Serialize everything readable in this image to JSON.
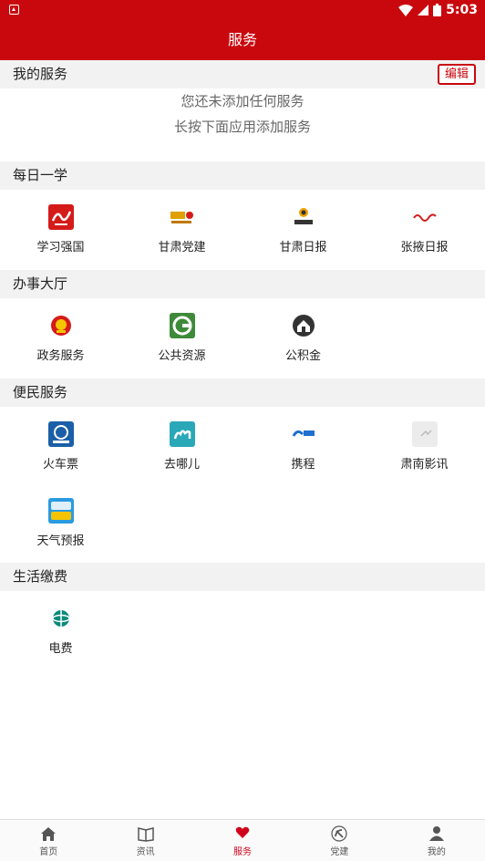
{
  "status_bar": {
    "time": "5:03"
  },
  "app_bar": {
    "title": "服务"
  },
  "my_services": {
    "title": "我的服务",
    "edit_label": "编辑",
    "empty_line1": "您还未添加任何服务",
    "empty_line2": "长按下面应用添加服务"
  },
  "sections": [
    {
      "title": "每日一学",
      "items": [
        {
          "label": "学习强国",
          "icon": "xuexi-qiangguo-icon"
        },
        {
          "label": "甘肃党建",
          "icon": "gansu-dangjian-icon"
        },
        {
          "label": "甘肃日报",
          "icon": "gansu-ribao-icon"
        },
        {
          "label": "张掖日报",
          "icon": "zhangye-ribao-icon"
        }
      ]
    },
    {
      "title": "办事大厅",
      "items": [
        {
          "label": "政务服务",
          "icon": "national-emblem-icon"
        },
        {
          "label": "公共资源",
          "icon": "public-resource-icon"
        },
        {
          "label": "公积金",
          "icon": "housing-fund-icon"
        }
      ]
    },
    {
      "title": "便民服务",
      "items": [
        {
          "label": "火车票",
          "icon": "train-12306-icon"
        },
        {
          "label": "去哪儿",
          "icon": "qunar-camel-icon"
        },
        {
          "label": "携程",
          "icon": "ctrip-icon"
        },
        {
          "label": "肃南影讯",
          "icon": "sunan-movie-icon"
        },
        {
          "label": "天气预报",
          "icon": "weather-forecast-icon"
        }
      ]
    },
    {
      "title": "生活缴费",
      "items": [
        {
          "label": "电费",
          "icon": "state-grid-electricity-icon"
        }
      ]
    }
  ],
  "tab_bar": {
    "tabs": [
      {
        "label": "首页",
        "icon": "home-icon"
      },
      {
        "label": "资讯",
        "icon": "news-icon"
      },
      {
        "label": "服务",
        "icon": "heart-icon",
        "active": true
      },
      {
        "label": "党建",
        "icon": "hammer-sickle-icon"
      },
      {
        "label": "我的",
        "icon": "user-icon"
      }
    ]
  },
  "colors": {
    "brand_red": "#c9080e",
    "section_bg": "#f2f2f2",
    "active_tab": "#d0021b"
  }
}
